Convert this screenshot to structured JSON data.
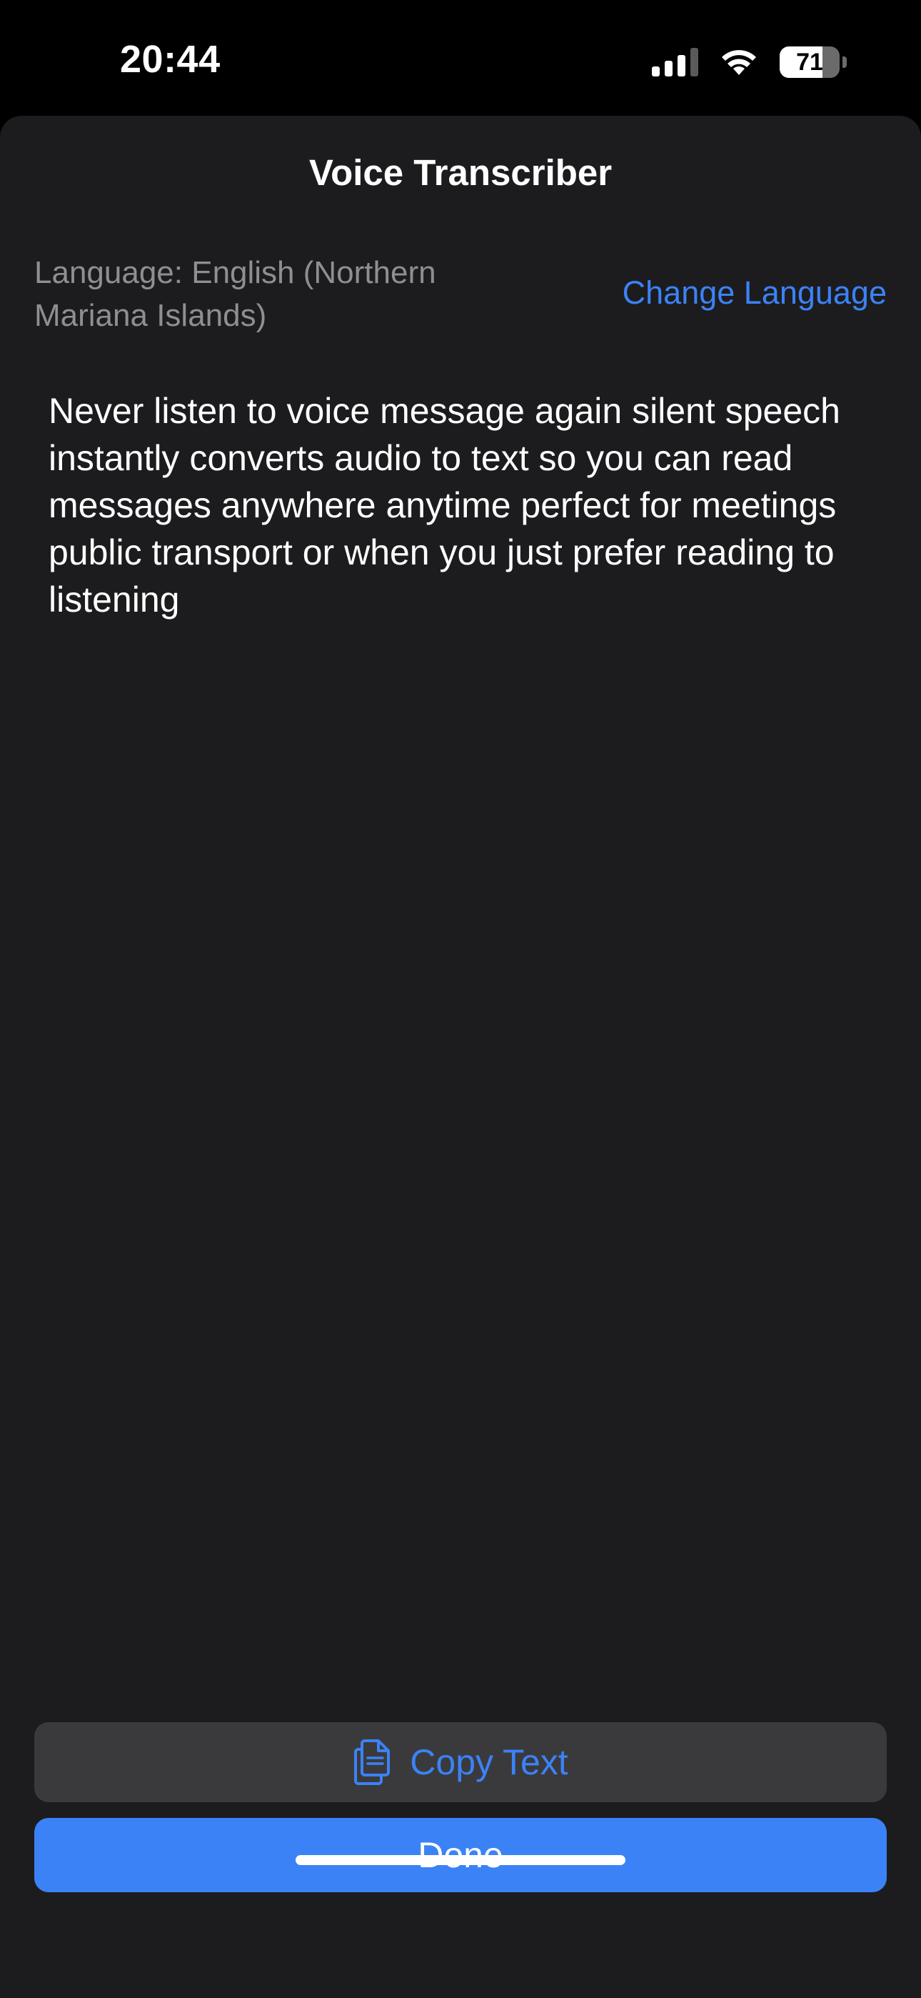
{
  "status_bar": {
    "time": "20:44",
    "battery_level": "71",
    "battery_fraction": 0.71,
    "signal_bars_active": 3,
    "signal_bars_total": 4,
    "icons": [
      "signal-icon",
      "wifi-icon",
      "battery-icon"
    ]
  },
  "sheet": {
    "title": "Voice Transcriber",
    "language_label": "Language: English (Northern Mariana Islands)",
    "change_language_label": "Change Language",
    "transcript": "Never listen to voice message again silent speech instantly converts audio to text so you can read messages anywhere anytime perfect for meetings public transport or when you just prefer reading to listening",
    "copy_button_label": "Copy Text",
    "copy_icon": "copy-icon",
    "done_button_label": "Done"
  },
  "colors": {
    "background": "#000000",
    "sheet_background": "#1c1c1e",
    "accent": "#3b82f6",
    "secondary_text": "#8e8e93",
    "copy_button_background": "#3a3a3c"
  }
}
